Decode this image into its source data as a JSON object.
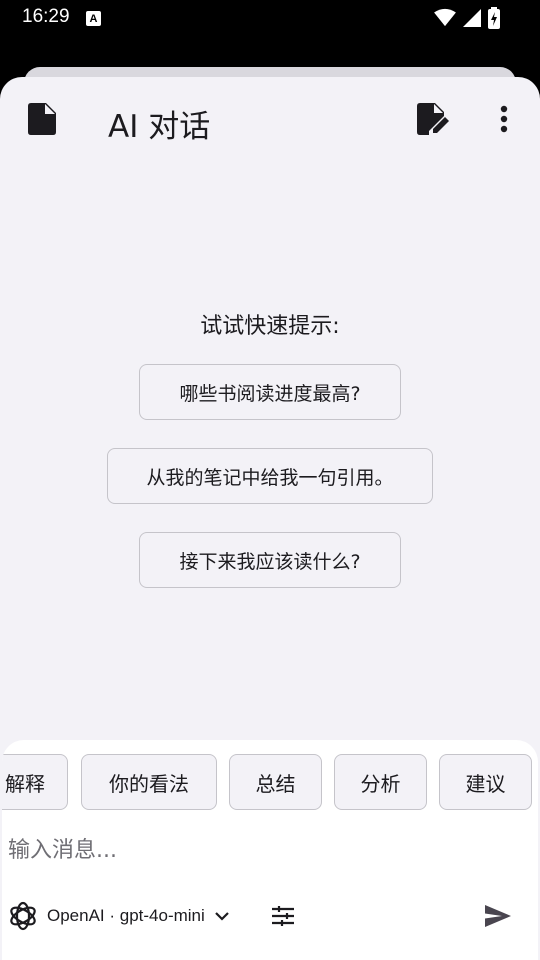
{
  "status_bar": {
    "time": "16:29",
    "notification_badge": "A",
    "icons": [
      "wifi-icon",
      "signal-icon",
      "battery-charging-icon"
    ]
  },
  "header": {
    "title": "AI 对话",
    "icons": [
      "document-icon",
      "edit-note-icon",
      "more-vert-icon"
    ]
  },
  "prompts": {
    "heading": "试试快速提示:",
    "items": [
      "哪些书阅读进度最高?",
      "从我的笔记中给我一句引用。",
      "接下来我应该读什么?"
    ]
  },
  "quick_chips": [
    "解释",
    "你的看法",
    "总结",
    "分析",
    "建议"
  ],
  "composer": {
    "placeholder": "输入消息...",
    "model_label": "OpenAI · gpt-4o-mini"
  },
  "colors": {
    "background": "#f3f2f7",
    "surface": "#ffffff",
    "outline": "#c5c4ca",
    "text": "#1c1b1f",
    "icon": "#49454f"
  }
}
